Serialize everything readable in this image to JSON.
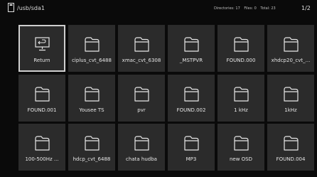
{
  "header": {
    "path": "/usb/sda1",
    "directories": "Directories: 17",
    "files": "Files: 0",
    "total": "Total: 23",
    "page": "1/2"
  },
  "grid": {
    "items": [
      {
        "label": "Return",
        "icon": "return-icon",
        "selected": true
      },
      {
        "label": "ciplus_cvt_6488",
        "icon": "folder-icon"
      },
      {
        "label": "xmac_cvt_6308",
        "icon": "folder-icon"
      },
      {
        "label": "_MSTPVR",
        "icon": "folder-icon"
      },
      {
        "label": "FOUND.000",
        "icon": "folder-icon"
      },
      {
        "label": "xhdcp20_cvt_...",
        "icon": "folder-icon"
      },
      {
        "label": "FOUND.001",
        "icon": "folder-icon"
      },
      {
        "label": "Yousee TS",
        "icon": "folder-icon"
      },
      {
        "label": "pvr",
        "icon": "folder-icon"
      },
      {
        "label": "FOUND.002",
        "icon": "folder-icon"
      },
      {
        "label": "1 kHz",
        "icon": "folder-icon"
      },
      {
        "label": "1kHz",
        "icon": "folder-icon"
      },
      {
        "label": "100-500Hz ...",
        "icon": "folder-icon"
      },
      {
        "label": "hdcp_cvt_6488",
        "icon": "folder-icon"
      },
      {
        "label": "chata hudba",
        "icon": "folder-icon"
      },
      {
        "label": "MP3",
        "icon": "folder-icon"
      },
      {
        "label": "new OSD",
        "icon": "folder-icon"
      },
      {
        "label": "FOUND.004",
        "icon": "folder-icon"
      }
    ]
  }
}
